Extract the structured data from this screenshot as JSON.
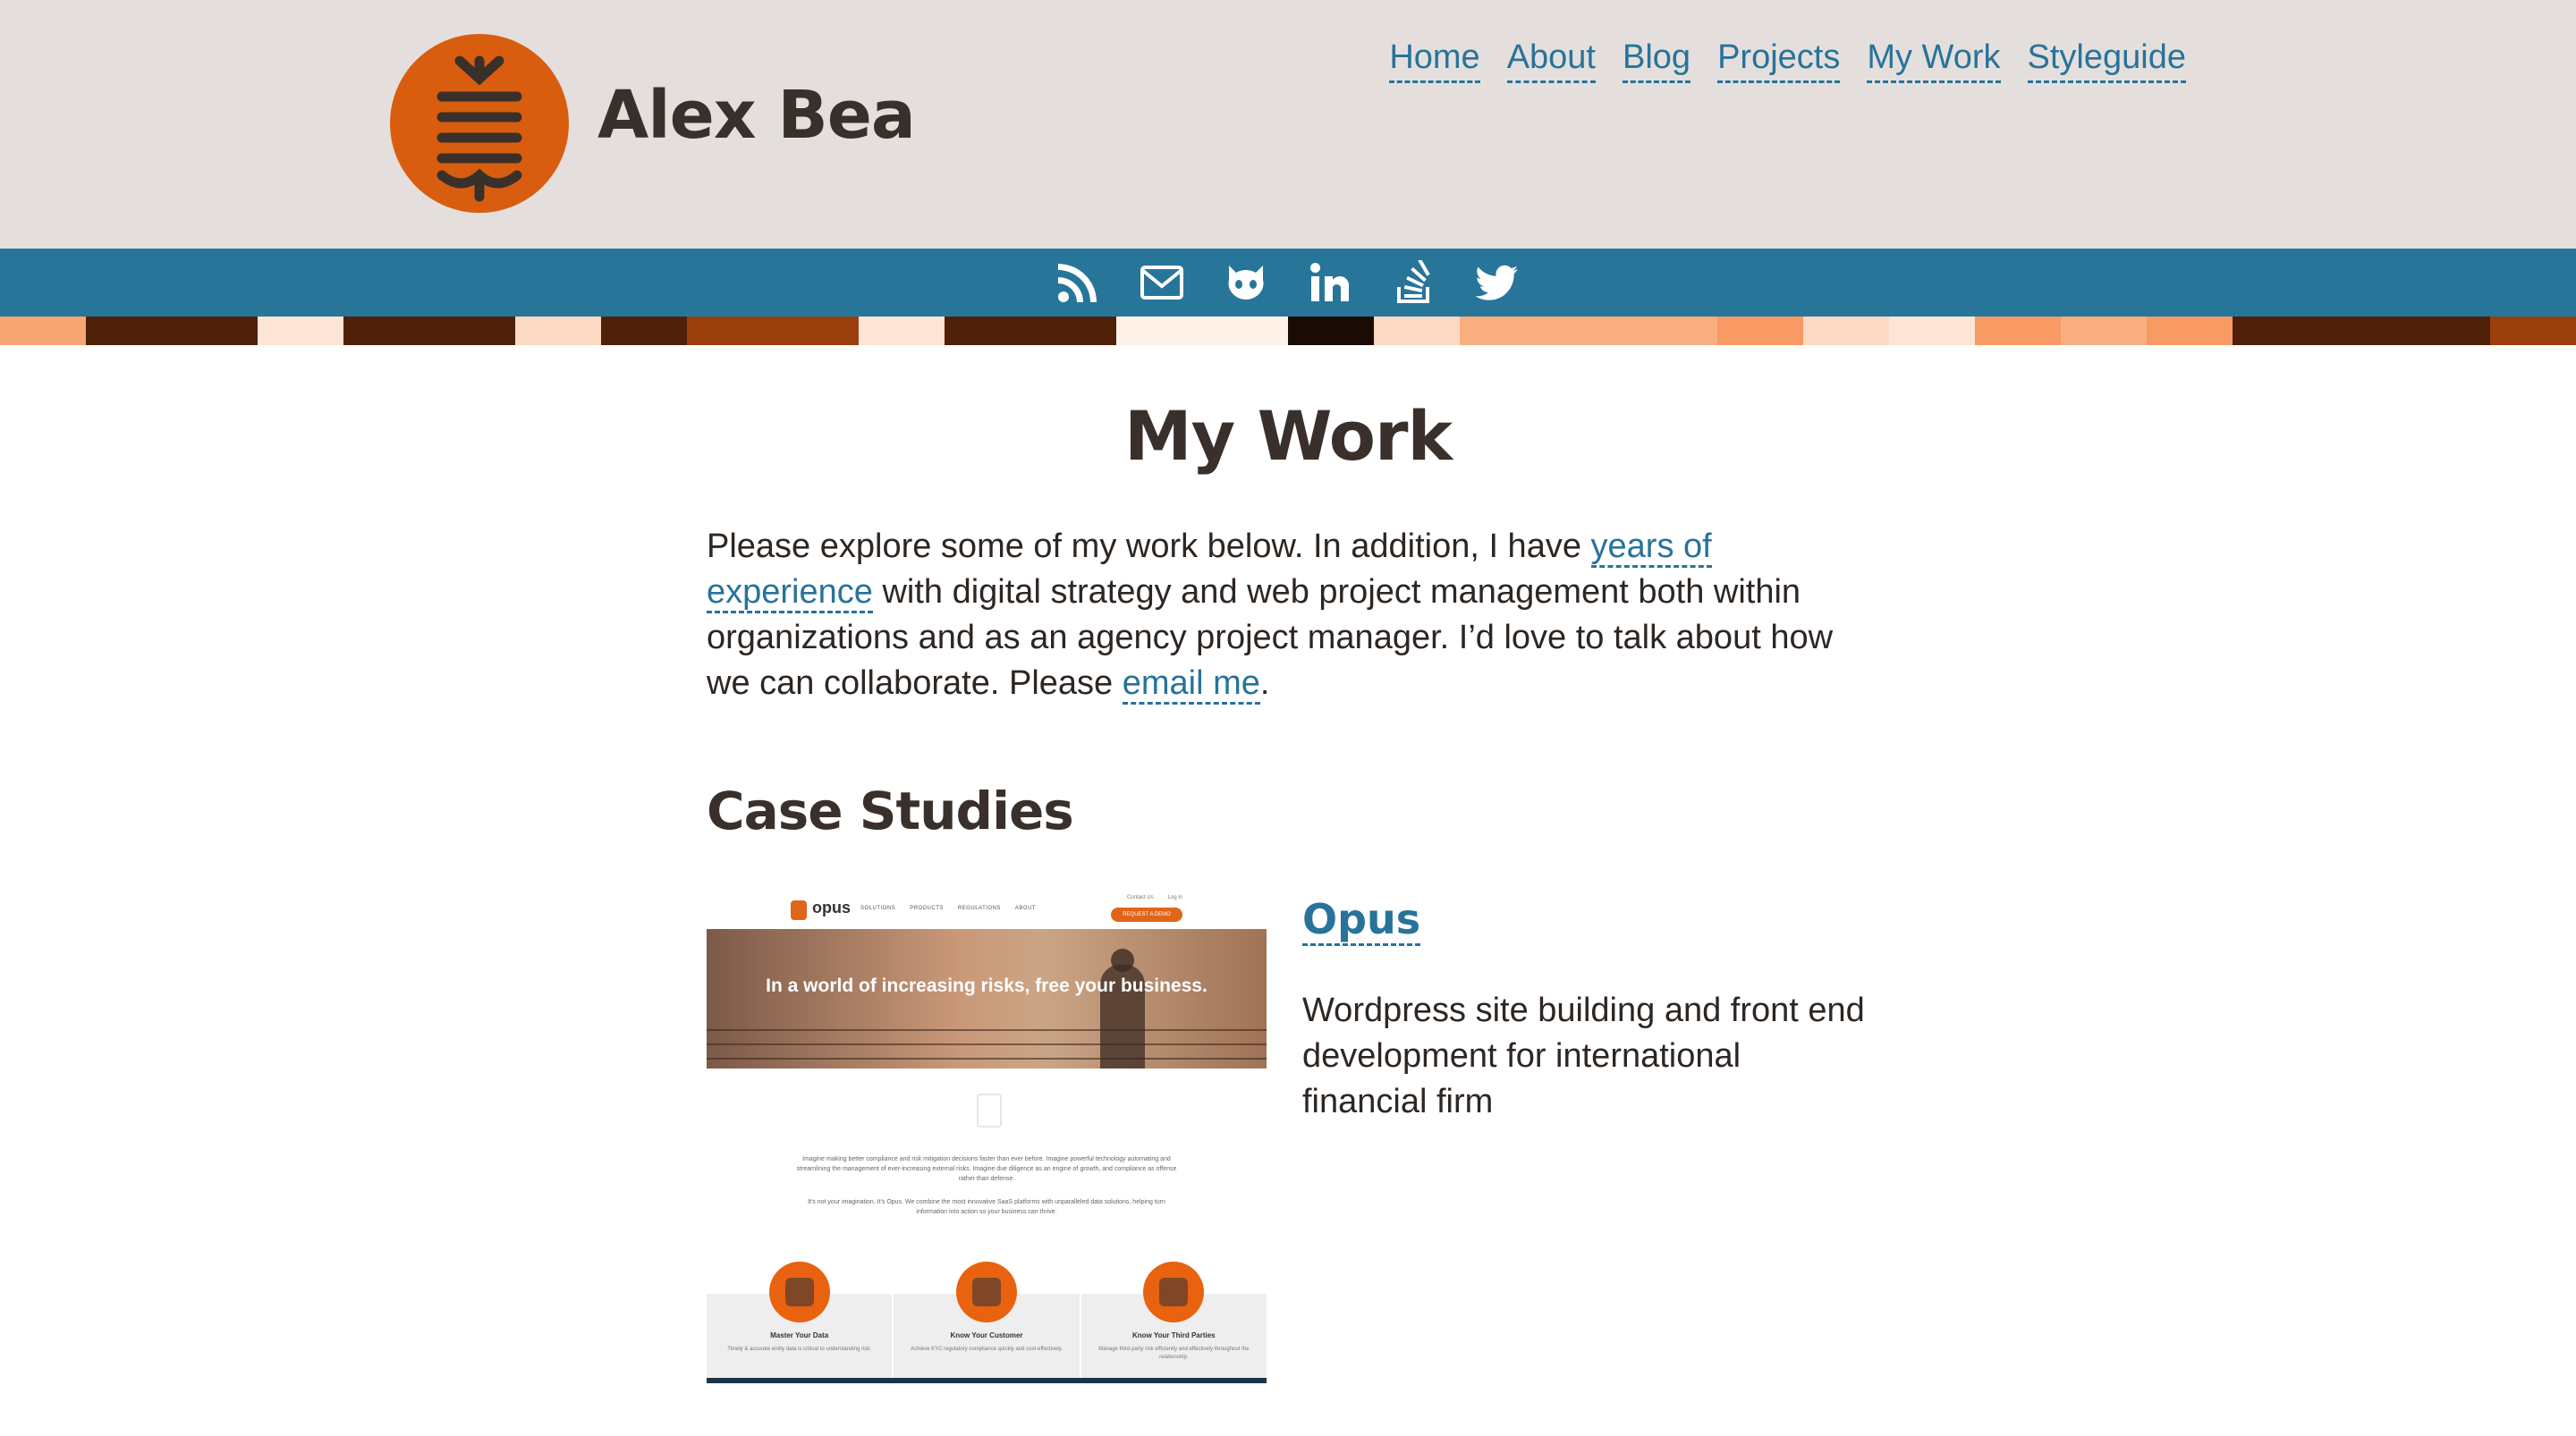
{
  "site": {
    "title": "Alex Bea",
    "logo_icon": "alex-bea-logo-icon",
    "logo_color": "#d95d0f"
  },
  "nav": {
    "items": [
      {
        "label": "Home"
      },
      {
        "label": "About"
      },
      {
        "label": "Blog"
      },
      {
        "label": "Projects"
      },
      {
        "label": "My Work"
      },
      {
        "label": "Styleguide"
      }
    ]
  },
  "social": {
    "background": "#27769a",
    "icons": [
      "rss-icon",
      "email-icon",
      "github-icon",
      "linkedin-icon",
      "stackoverflow-icon",
      "twitter-icon"
    ]
  },
  "stripe_colors": [
    "#f9a674",
    "#4e2007",
    "#4e2007",
    "#fde5d5",
    "#4e2007",
    "#4e2007",
    "#fcd9c2",
    "#4e2007",
    "#9a3e0c",
    "#9a3e0c",
    "#fde5d5",
    "#4e2007",
    "#4e2007",
    "#fef1e8",
    "#fef1e8",
    "#1a0c04",
    "#fcd9c2",
    "#f9ae80",
    "#f9ae80",
    "#f9ae80",
    "#f79a63",
    "#fcd9c2",
    "#fde5d5",
    "#f79a63",
    "#f9ae80",
    "#f79a63",
    "#4e2007",
    "#4e2007",
    "#4e2007",
    "#9a3e0c"
  ],
  "page": {
    "title": "My Work",
    "intro_before": "Please explore some of my work below. In addition, I have ",
    "intro_link": "years of experience",
    "intro_middle": " with digital strategy and web project management both within organizations and as an agency project manager. I’d love to talk about how we can collaborate. Please ",
    "intro_link2": "email me",
    "intro_after": "."
  },
  "case_studies": {
    "heading": "Case Studies",
    "items": [
      {
        "title": "Opus",
        "description": "Wordpress site building and front end development for international financial firm",
        "thumbnail": {
          "logo_text": "opus",
          "nav_links": [
            "SOLUTIONS",
            "PRODUCTS",
            "REGULATIONS",
            "ABOUT"
          ],
          "top_links": [
            "Contact Us",
            "Log in"
          ],
          "cta": "REQUEST A DEMO",
          "hero_text": "In a world of increasing risks, free your business.",
          "paragraph_1": "Imagine making better compliance and risk mitigation decisions faster than ever before. Imagine powerful technology automating and streamlining the management of ever-increasing external risks. Imagine due diligence as an engine of growth, and compliance as offense rather than defense.",
          "paragraph_2": "It's not your imagination. It's Opus. We combine the most innovative SaaS platforms with unparalleled data solutions, helping turn information into action so your business can thrive.",
          "features": [
            {
              "title": "Master Your Data",
              "desc": "Timely & accurate entity data is critical to understanding risk."
            },
            {
              "title": "Know Your Customer",
              "desc": "Achieve KYC regulatory compliance quickly and cost-effectively."
            },
            {
              "title": "Know Your Third Parties",
              "desc": "Manage third-party risk efficiently and effectively throughout the relationship."
            }
          ]
        }
      }
    ]
  }
}
